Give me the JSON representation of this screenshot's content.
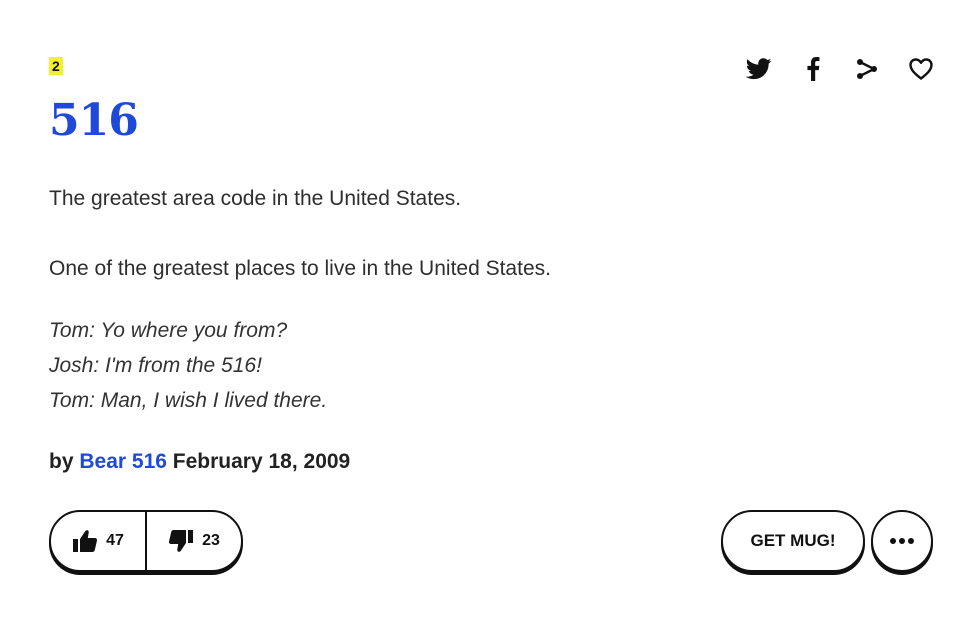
{
  "definition": {
    "rank": "2",
    "word": "516",
    "meaning": [
      "The greatest area code in the United States.",
      "One of the greatest places to live in the United States."
    ],
    "example": [
      "Tom: Yo where you from?",
      "Josh: I'm from the 516!",
      "Tom: Man, I wish I lived there."
    ],
    "byline_prefix": "by",
    "author": "Bear 516",
    "date": "February 18, 2009"
  },
  "share": {
    "icons": [
      "twitter-icon",
      "facebook-icon",
      "share-icon",
      "heart-icon"
    ]
  },
  "votes": {
    "up_count": "47",
    "down_count": "23"
  },
  "actions": {
    "mug_label": "GET MUG!",
    "more_icon": "more-dots-icon"
  },
  "colors": {
    "title": "#1f49d8",
    "highlight": "#f1f22a",
    "ink": "#111111"
  }
}
